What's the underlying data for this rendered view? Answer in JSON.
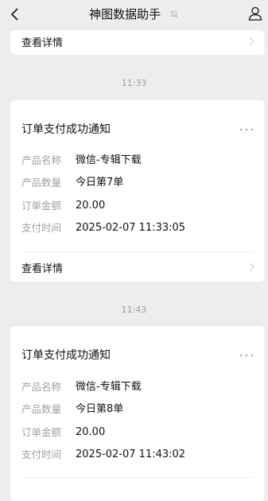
{
  "header": {
    "title": "神图数据助手",
    "back_icon": "back-arrow-icon",
    "mute_icon": "bell-muted-icon",
    "profile_icon": "person-icon"
  },
  "top_card": {
    "link_label": "查看详情"
  },
  "messages": [
    {
      "time": "11:33",
      "title": "订单支付成功通知",
      "fields": [
        {
          "label": "产品名称",
          "value": "微信-专辑下载"
        },
        {
          "label": "产品数量",
          "value": "今日第7单"
        },
        {
          "label": "订单金额",
          "value": "20.00"
        },
        {
          "label": "支付时间",
          "value": "2025-02-07 11:33:05"
        }
      ],
      "link_label": "查看详情"
    },
    {
      "time": "11:43",
      "title": "订单支付成功通知",
      "fields": [
        {
          "label": "产品名称",
          "value": "微信-专辑下载"
        },
        {
          "label": "产品数量",
          "value": "今日第8单"
        },
        {
          "label": "订单金额",
          "value": "20.00"
        },
        {
          "label": "支付时间",
          "value": "2025-02-07 11:43:02"
        }
      ]
    }
  ]
}
